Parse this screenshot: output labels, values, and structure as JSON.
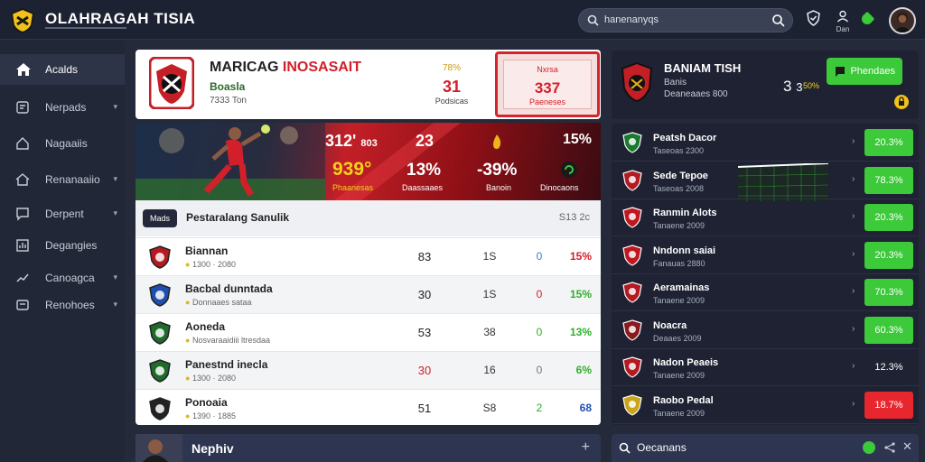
{
  "app": {
    "title": "OLAHRAGAH TISIA"
  },
  "search": {
    "value": "hanenanyqs"
  },
  "top_icons": {
    "user_label": "Dan"
  },
  "sidebar": {
    "items": [
      {
        "label": "Acalds",
        "icon": "home-icon",
        "chevron": false
      },
      {
        "label": "Nerpads",
        "icon": "ticket-icon",
        "chevron": true
      },
      {
        "label": "Nagaaiis",
        "icon": "house-icon",
        "chevron": false
      },
      {
        "label": "Renanaaiio",
        "icon": "home-outline-icon",
        "chevron": true
      },
      {
        "label": "Derpent",
        "icon": "chat-icon",
        "chevron": true
      },
      {
        "label": "Degangies",
        "icon": "stats-icon",
        "chevron": false
      },
      {
        "label": "Canoagca",
        "icon": "trend-icon",
        "chevron": true
      },
      {
        "label": "Renohoes",
        "icon": "card-icon",
        "chevron": true
      }
    ]
  },
  "match": {
    "title_black": "MARICAG",
    "title_red": "INOSASAIT",
    "team": "Boasla",
    "sub": "7333 Ton",
    "center_top": "78%",
    "center_value": "31",
    "center_sub": "Podsicas",
    "box_top": "Nxrsa",
    "box_value": "337",
    "box_sub": "Paeneses"
  },
  "banner": {
    "stats": [
      {
        "value": "312'",
        "sub": "803"
      },
      {
        "value": "23"
      },
      {
        "value": "15%"
      },
      {
        "value": "939°",
        "label": "Phaanesas"
      },
      {
        "value": "13%",
        "label": "Daassaaes"
      },
      {
        "value": "-39%",
        "label": "Banoin"
      },
      {
        "label": "Dinocaons"
      }
    ]
  },
  "table": {
    "tag": "Mads",
    "title": "Pestaralang Sanulik",
    "header_right": "S13 2c",
    "rows": [
      {
        "name": "Biannan",
        "sub": "1300 · 2080",
        "c1": "83",
        "c2": "1S",
        "c3": "0",
        "c4": "15%",
        "c1_color": "#222222",
        "c3_color": "#3b7bd8",
        "c4_color": "#d1202a",
        "crest": "#b31a22"
      },
      {
        "name": "Bacbal dunntada",
        "sub": "Donnaaes sataa",
        "c1": "30",
        "c2": "1S",
        "c3": "0",
        "c4": "15%",
        "c1_color": "#222222",
        "c3_color": "#d1202a",
        "c4_color": "#2fae2c",
        "crest": "#1f4fae"
      },
      {
        "name": "Aoneda",
        "sub": "Nosvaraaidiii ltresdaa",
        "c1": "53",
        "c2": "38",
        "c3": "0",
        "c4": "13%",
        "c1_color": "#222222",
        "c3_color": "#2fae2c",
        "c4_color": "#2fae2c",
        "crest": "#1f6b2b"
      },
      {
        "name": "Panestnd inecla",
        "sub": "1300 · 2080",
        "c1": "30",
        "c2": "16",
        "c3": "0",
        "c4": "6%",
        "c1_color": "#d1202a",
        "c3_color": "#777777",
        "c4_color": "#2fae2c",
        "crest": "#1f6b2b"
      },
      {
        "name": "Ponoaia",
        "sub": "1390 · 1885",
        "c1": "51",
        "c2": "S8",
        "c3": "2",
        "c4": "68",
        "c1_color": "#222222",
        "c3_color": "#2fae2c",
        "c4_color": "#1f4fae",
        "crest": "#222222"
      }
    ]
  },
  "news": {
    "label": "Nephiv",
    "plus": "+"
  },
  "right_card": {
    "title": "BANIAM TISH",
    "sub1": "Banis",
    "sub2": "Deaneaaes 800",
    "score": "3",
    "score2": "3",
    "pct": "50%",
    "button": "Phendaes"
  },
  "right_list": [
    {
      "name": "Peatsh Dacor",
      "sub": "Taseoas 2300",
      "odd": "20.3%",
      "kind": "green",
      "crest": "#1a7a30"
    },
    {
      "name": "Sede Tepoe",
      "sub": "Taseoas 2008",
      "odd": "78.3%",
      "kind": "green",
      "crest": "#b31a22"
    },
    {
      "name": "Ranmin Alots",
      "sub": "Tanaene 2009",
      "odd": "20.3%",
      "kind": "green",
      "crest": "#c01820"
    },
    {
      "name": "Nndonn saiai",
      "sub": "Fanauas 2880",
      "odd": "20.3%",
      "kind": "green",
      "crest": "#c01820"
    },
    {
      "name": "Aeramainas",
      "sub": "Tanaene 2009",
      "odd": "70.3%",
      "kind": "green",
      "crest": "#b31a22"
    },
    {
      "name": "Noacra",
      "sub": "Deaaes 2009",
      "odd": "60.3%",
      "kind": "green",
      "crest": "#8a1a20"
    },
    {
      "name": "Nadon Peaeis",
      "sub": "Tanaene 2009",
      "odd": "12.3%",
      "kind": "none",
      "crest": "#b31a22"
    },
    {
      "name": "Raobo Pedal",
      "sub": "Tanaene 2009",
      "odd": "18.7%",
      "kind": "red",
      "crest": "#c9a51a"
    }
  ],
  "right_bottom": {
    "label": "Oecanans"
  }
}
